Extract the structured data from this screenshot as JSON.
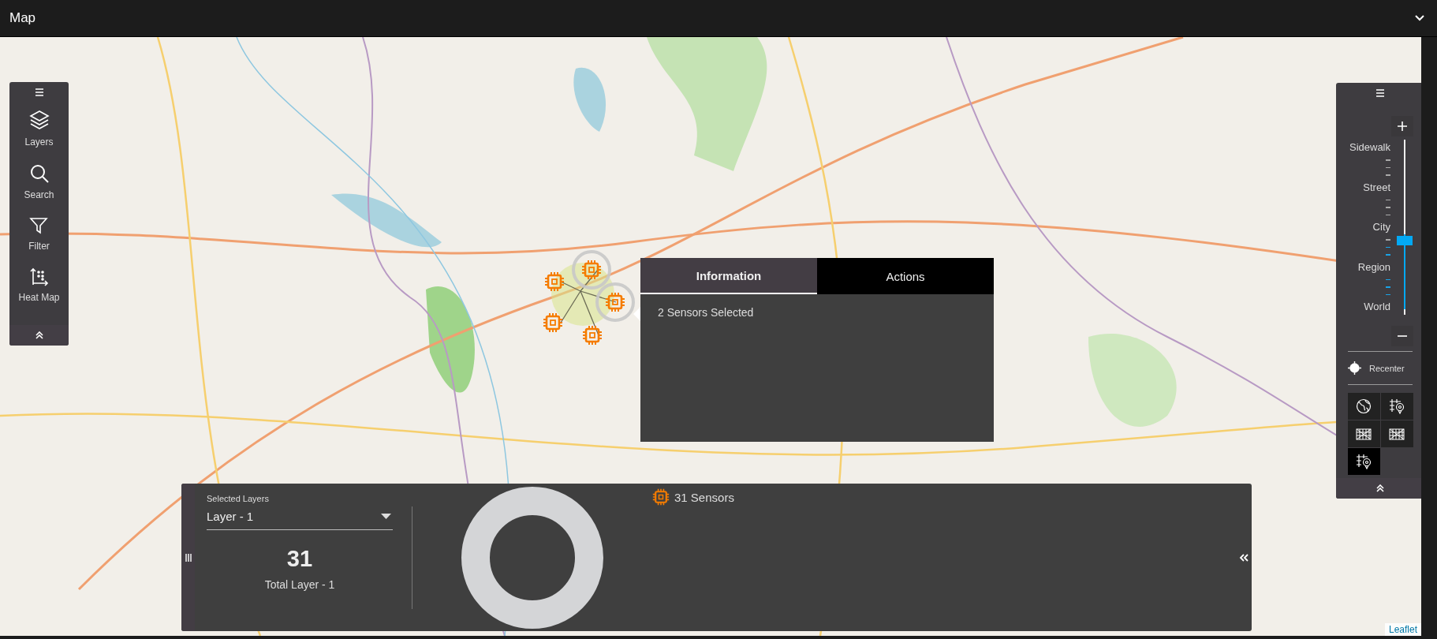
{
  "header": {
    "title": "Map"
  },
  "left_toolbar": {
    "items": [
      {
        "label": "Layers",
        "kind": "layers"
      },
      {
        "label": "Search",
        "kind": "search"
      },
      {
        "label": "Filter",
        "kind": "filter"
      },
      {
        "label": "Heat Map",
        "kind": "heatmap"
      }
    ]
  },
  "zoom_control": {
    "levels": [
      "Sidewalk",
      "Street",
      "City",
      "Region",
      "World"
    ],
    "level": 0.43,
    "recenter": "Recenter"
  },
  "basemaps": [
    {
      "kind": "globe",
      "selected": false
    },
    {
      "kind": "pin",
      "selected": false
    },
    {
      "kind": "grid",
      "selected": false
    },
    {
      "kind": "grid",
      "selected": false
    },
    {
      "kind": "pin",
      "selected": true
    }
  ],
  "markers": [
    {
      "selected": false
    },
    {
      "selected": true
    },
    {
      "selected": true
    },
    {
      "selected": false
    },
    {
      "selected": false
    }
  ],
  "popup": {
    "tabs": [
      {
        "label": "Information",
        "selected": true
      },
      {
        "label": "Actions",
        "selected": false
      }
    ],
    "text": "2 Sensors Selected"
  },
  "bottom_panel": {
    "field_label": "Selected Layers",
    "field_value": "Layer - 1",
    "total": "31",
    "total_label": "Total Layer - 1",
    "legend": [
      {
        "label": "31 Sensors"
      }
    ]
  },
  "attribution": "Leaflet"
}
